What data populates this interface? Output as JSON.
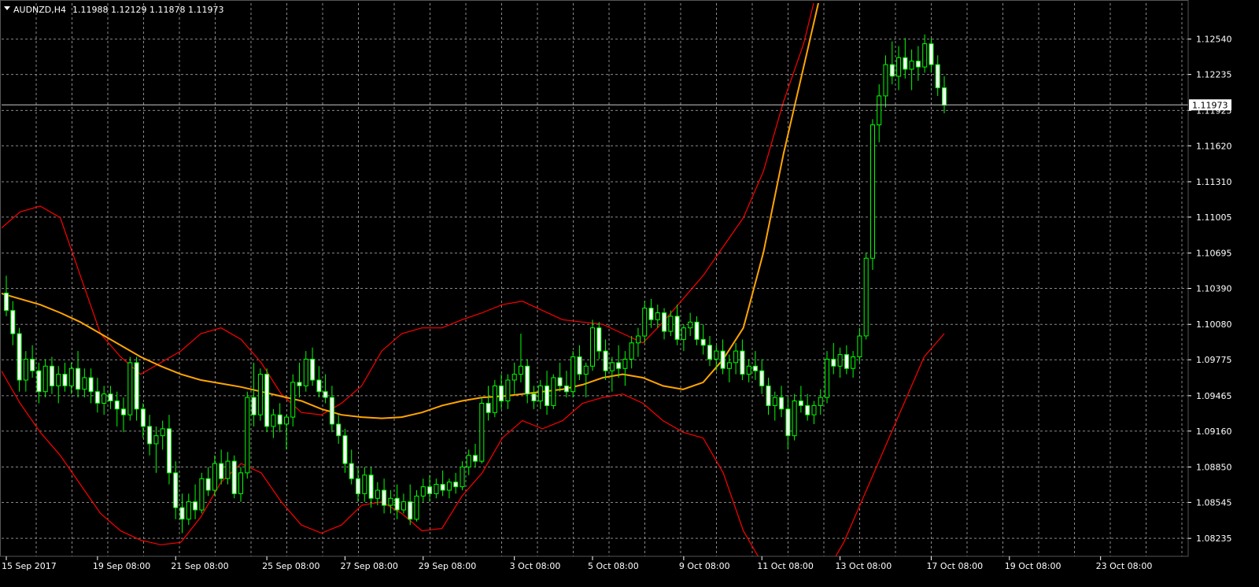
{
  "header": {
    "symbol": "AUDNZD,H4",
    "ohlc": "1.11988 1.12129 1.11878 1.11973"
  },
  "colors": {
    "background": "#000000",
    "grid": "#8a8a8a",
    "axis": "#ffffff",
    "bull_candle": "#00ff00",
    "bull_body": "#000000",
    "bear_candle": "#00ff00",
    "bear_body": "#ffffff",
    "bollinger": "#ff0000",
    "moving_average": "#ffa500",
    "price_line": "#c8c8c8"
  },
  "chart_data": {
    "type": "candlestick",
    "symbol": "AUDNZD",
    "timeframe": "H4",
    "current_price": "1.11973",
    "ylim": [
      1.0808,
      1.1285
    ],
    "y_ticks": [
      "1.12540",
      "1.12235",
      "1.11925",
      "1.11620",
      "1.11310",
      "1.11005",
      "1.10695",
      "1.10390",
      "1.10080",
      "1.09775",
      "1.09465",
      "1.09160",
      "1.08850",
      "1.08545",
      "1.08235"
    ],
    "x_ticks": [
      {
        "label": "15 Sep 2017",
        "bar": 0
      },
      {
        "label": "19 Sep 08:00",
        "bar": 14
      },
      {
        "label": "21 Sep 08:00",
        "bar": 26
      },
      {
        "label": "25 Sep 08:00",
        "bar": 40
      },
      {
        "label": "27 Sep 08:00",
        "bar": 52
      },
      {
        "label": "29 Sep 08:00",
        "bar": 64
      },
      {
        "label": "3 Oct 08:00",
        "bar": 78
      },
      {
        "label": "5 Oct 08:00",
        "bar": 90
      },
      {
        "label": "9 Oct 08:00",
        "bar": 104
      },
      {
        "label": "11 Oct 08:00",
        "bar": 116
      },
      {
        "label": "13 Oct 08:00",
        "bar": 128
      },
      {
        "label": "17 Oct 08:00",
        "bar": 142
      },
      {
        "label": "19 Oct 08:00",
        "bar": 154
      },
      {
        "label": "23 Oct 08:00",
        "bar": 168
      }
    ],
    "candles": [
      [
        1.1035,
        1.105,
        1.1015,
        1.102
      ],
      [
        1.102,
        1.1028,
        1.099,
        1.1
      ],
      [
        1.1,
        1.1005,
        1.095,
        1.096
      ],
      [
        1.096,
        1.0985,
        1.095,
        1.0978
      ],
      [
        1.0978,
        1.099,
        1.0962,
        1.0968
      ],
      [
        1.0968,
        1.0975,
        1.094,
        1.095
      ],
      [
        1.095,
        1.0978,
        1.0945,
        1.0972
      ],
      [
        1.0972,
        1.098,
        1.0948,
        1.0955
      ],
      [
        1.0955,
        1.0972,
        1.094,
        1.0965
      ],
      [
        1.0965,
        1.0975,
        1.095,
        1.0955
      ],
      [
        1.0955,
        1.0975,
        1.0948,
        1.097
      ],
      [
        1.097,
        1.0985,
        1.0945,
        1.0952
      ],
      [
        1.0952,
        1.097,
        1.0945,
        1.0962
      ],
      [
        1.0962,
        1.097,
        1.094,
        1.095
      ],
      [
        1.095,
        1.0962,
        1.0932,
        1.094
      ],
      [
        1.094,
        1.0955,
        1.093,
        1.0948
      ],
      [
        1.0948,
        1.0955,
        1.0935,
        1.0942
      ],
      [
        1.0942,
        1.095,
        1.092,
        1.0935
      ],
      [
        1.0935,
        1.0945,
        1.0915,
        1.093
      ],
      [
        1.093,
        1.098,
        1.0925,
        1.0975
      ],
      [
        1.0975,
        1.098,
        1.0925,
        1.0935
      ],
      [
        1.0935,
        1.094,
        1.091,
        1.092
      ],
      [
        1.092,
        1.093,
        1.0895,
        1.0905
      ],
      [
        1.0905,
        1.092,
        1.088,
        1.0912
      ],
      [
        1.0912,
        1.0925,
        1.09,
        1.0918
      ],
      [
        1.0918,
        1.093,
        1.087,
        1.088
      ],
      [
        1.088,
        1.089,
        1.084,
        1.085
      ],
      [
        1.085,
        1.0862,
        1.0828,
        1.084
      ],
      [
        1.084,
        1.0862,
        1.0835,
        1.0855
      ],
      [
        1.0855,
        1.087,
        1.084,
        1.0848
      ],
      [
        1.0848,
        1.088,
        1.0845,
        1.0875
      ],
      [
        1.0875,
        1.0885,
        1.086,
        1.0865
      ],
      [
        1.0865,
        1.0895,
        1.086,
        1.0888
      ],
      [
        1.0888,
        1.09,
        1.087,
        1.0875
      ],
      [
        1.0875,
        1.0898,
        1.087,
        1.089
      ],
      [
        1.089,
        1.0895,
        1.0858,
        1.0862
      ],
      [
        1.0862,
        1.0885,
        1.0855,
        1.088
      ],
      [
        1.088,
        1.095,
        1.0875,
        1.0945
      ],
      [
        1.0945,
        1.0975,
        1.092,
        1.093
      ],
      [
        1.093,
        1.097,
        1.0925,
        1.0965
      ],
      [
        1.0965,
        1.097,
        1.0915,
        1.092
      ],
      [
        1.092,
        1.0935,
        1.091,
        1.093
      ],
      [
        1.093,
        1.094,
        1.0915,
        1.0922
      ],
      [
        1.0922,
        1.093,
        1.09,
        1.0928
      ],
      [
        1.0928,
        1.0965,
        1.092,
        1.0958
      ],
      [
        1.0958,
        1.0975,
        1.0945,
        1.0955
      ],
      [
        1.0955,
        1.0985,
        1.095,
        1.0978
      ],
      [
        1.0978,
        1.0988,
        1.0955,
        1.096
      ],
      [
        1.096,
        1.0972,
        1.0945,
        1.095
      ],
      [
        1.095,
        1.0965,
        1.094,
        1.0945
      ],
      [
        1.0945,
        1.0955,
        1.0915,
        1.0922
      ],
      [
        1.0922,
        1.093,
        1.0905,
        1.0912
      ],
      [
        1.0912,
        1.0918,
        1.088,
        1.0888
      ],
      [
        1.0888,
        1.09,
        1.087,
        1.0875
      ],
      [
        1.0875,
        1.0885,
        1.0855,
        1.0862
      ],
      [
        1.0862,
        1.0885,
        1.0855,
        1.0878
      ],
      [
        1.0878,
        1.0885,
        1.085,
        1.0858
      ],
      [
        1.0858,
        1.0872,
        1.0852,
        1.0865
      ],
      [
        1.0865,
        1.0875,
        1.0845,
        1.0852
      ],
      [
        1.0852,
        1.0865,
        1.0845,
        1.0858
      ],
      [
        1.0858,
        1.087,
        1.084,
        1.0848
      ],
      [
        1.0848,
        1.0862,
        1.0845,
        1.0855
      ],
      [
        1.0855,
        1.087,
        1.0835,
        1.084
      ],
      [
        1.084,
        1.0865,
        1.0838,
        1.086
      ],
      [
        1.086,
        1.0875,
        1.0855,
        1.0868
      ],
      [
        1.0868,
        1.0878,
        1.0855,
        1.0862
      ],
      [
        1.0862,
        1.0875,
        1.0858,
        1.087
      ],
      [
        1.087,
        1.0882,
        1.086,
        1.0865
      ],
      [
        1.0865,
        1.0875,
        1.0858,
        1.0872
      ],
      [
        1.0872,
        1.088,
        1.0862,
        1.0868
      ],
      [
        1.0868,
        1.089,
        1.0865,
        1.0885
      ],
      [
        1.0885,
        1.09,
        1.0878,
        1.0895
      ],
      [
        1.0895,
        1.0905,
        1.0885,
        1.089
      ],
      [
        1.089,
        1.0945,
        1.0888,
        1.094
      ],
      [
        1.094,
        1.0955,
        1.0925,
        1.0932
      ],
      [
        1.0932,
        1.096,
        1.0928,
        1.0955
      ],
      [
        1.0955,
        1.0965,
        1.0935,
        1.0942
      ],
      [
        1.0942,
        1.0965,
        1.0935,
        1.096
      ],
      [
        1.096,
        1.0975,
        1.0948,
        1.0965
      ],
      [
        1.0965,
        1.1,
        1.0958,
        1.0972
      ],
      [
        1.0972,
        1.0978,
        1.094,
        1.0948
      ],
      [
        1.0948,
        1.0955,
        1.0935,
        1.0942
      ],
      [
        1.0942,
        1.096,
        1.0935,
        1.0955
      ],
      [
        1.0955,
        1.0968,
        1.093,
        1.0938
      ],
      [
        1.0938,
        1.0965,
        1.0935,
        1.0962
      ],
      [
        1.0962,
        1.0975,
        1.095,
        1.0955
      ],
      [
        1.0955,
        1.0968,
        1.0945,
        1.095
      ],
      [
        1.095,
        1.0985,
        1.0945,
        1.098
      ],
      [
        1.098,
        1.099,
        1.096,
        1.0965
      ],
      [
        1.0965,
        1.0975,
        1.0945,
        1.0972
      ],
      [
        1.0972,
        1.1012,
        1.0968,
        1.1005
      ],
      [
        1.1005,
        1.101,
        1.0978,
        1.0985
      ],
      [
        1.0985,
        1.0995,
        1.096,
        1.0968
      ],
      [
        1.0968,
        1.098,
        1.095,
        1.0975
      ],
      [
        1.0975,
        1.099,
        1.0962,
        1.097
      ],
      [
        1.097,
        1.0985,
        1.0955,
        1.0978
      ],
      [
        1.0978,
        1.0998,
        1.097,
        1.0992
      ],
      [
        1.0992,
        1.1005,
        1.098,
        1.0998
      ],
      [
        1.0998,
        1.1028,
        1.0992,
        1.1022
      ],
      [
        1.1022,
        1.103,
        1.1005,
        1.1012
      ],
      [
        1.1012,
        1.1025,
        1.1005,
        1.1018
      ],
      [
        1.1018,
        1.1022,
        1.0995,
        1.1002
      ],
      [
        1.1002,
        1.102,
        1.0998,
        1.1015
      ],
      [
        1.1015,
        1.1025,
        1.099,
        1.0995
      ],
      [
        1.0995,
        1.1008,
        1.0985,
        1.1005
      ],
      [
        1.1005,
        1.1018,
        1.0998,
        1.101
      ],
      [
        1.101,
        1.1015,
        1.099,
        1.0995
      ],
      [
        1.0995,
        1.1008,
        1.0982,
        1.099
      ],
      [
        1.099,
        1.0998,
        1.0972,
        1.0978
      ],
      [
        1.0978,
        1.099,
        1.0968,
        1.0985
      ],
      [
        1.0985,
        1.0995,
        1.0965,
        1.097
      ],
      [
        1.097,
        1.0982,
        1.0958,
        1.0975
      ],
      [
        1.0975,
        1.0992,
        1.0965,
        1.0985
      ],
      [
        1.0985,
        1.0995,
        1.096,
        1.0965
      ],
      [
        1.0965,
        1.0978,
        1.0958,
        1.0972
      ],
      [
        1.0972,
        1.0985,
        1.096,
        1.0968
      ],
      [
        1.0968,
        1.0978,
        1.0948,
        1.0955
      ],
      [
        1.0955,
        1.0962,
        1.093,
        1.0938
      ],
      [
        1.0938,
        1.095,
        1.0925,
        1.0945
      ],
      [
        1.0945,
        1.0955,
        1.0928,
        1.0935
      ],
      [
        1.0935,
        1.0945,
        1.09,
        1.0912
      ],
      [
        1.0912,
        1.0948,
        1.0908,
        1.0942
      ],
      [
        1.0942,
        1.0955,
        1.0932,
        1.0938
      ],
      [
        1.0938,
        1.0948,
        1.0925,
        1.093
      ],
      [
        1.093,
        1.0942,
        1.0922,
        1.0938
      ],
      [
        1.0938,
        1.0952,
        1.093,
        1.0945
      ],
      [
        1.0945,
        1.0985,
        1.094,
        1.0978
      ],
      [
        1.0978,
        1.0992,
        1.0965,
        1.0972
      ],
      [
        1.0972,
        1.0988,
        1.0962,
        1.0982
      ],
      [
        1.0982,
        1.099,
        1.0965,
        1.097
      ],
      [
        1.097,
        1.0985,
        1.0962,
        1.098
      ],
      [
        1.098,
        1.1005,
        1.0975,
        1.0998
      ],
      [
        1.0998,
        1.107,
        1.0995,
        1.1065
      ],
      [
        1.1065,
        1.1185,
        1.1055,
        1.118
      ],
      [
        1.118,
        1.1215,
        1.1165,
        1.1205
      ],
      [
        1.1205,
        1.124,
        1.1195,
        1.1232
      ],
      [
        1.1232,
        1.1252,
        1.1215,
        1.1222
      ],
      [
        1.1222,
        1.1248,
        1.121,
        1.1238
      ],
      [
        1.1238,
        1.1255,
        1.122,
        1.1228
      ],
      [
        1.1228,
        1.1245,
        1.121,
        1.1235
      ],
      [
        1.1235,
        1.1248,
        1.1218,
        1.123
      ],
      [
        1.123,
        1.1258,
        1.1225,
        1.125
      ],
      [
        1.125,
        1.1255,
        1.1225,
        1.1232
      ],
      [
        1.1232,
        1.124,
        1.1205,
        1.1212
      ],
      [
        1.1212,
        1.1222,
        1.119,
        1.1197
      ]
    ],
    "bands": {
      "ma": [
        1.1035,
        1.103,
        1.1025,
        1.1018,
        1.101,
        1.1,
        1.099,
        1.098,
        1.0972,
        1.0965,
        1.096,
        1.0957,
        1.0954,
        1.095,
        1.0946,
        1.0942,
        1.0935,
        1.093,
        1.0928,
        1.0927,
        1.0928,
        1.0932,
        1.0938,
        1.0942,
        1.0945,
        1.0946,
        1.0948,
        1.095,
        1.0952,
        1.0956,
        1.0962,
        1.0965,
        1.0962,
        1.0955,
        1.0952,
        1.0958,
        1.0978,
        1.1005,
        1.107,
        1.1155,
        1.123,
        1.1305,
        1.137,
        1.143,
        1.148,
        1.153,
        1.156,
        1.1595
      ],
      "upper": [
        1.109,
        1.1105,
        1.111,
        1.11,
        1.105,
        1.1,
        1.098,
        1.0965,
        1.0975,
        1.0985,
        1.1,
        1.1005,
        1.0995,
        1.0975,
        1.0948,
        1.0932,
        1.093,
        1.094,
        1.0955,
        1.0985,
        1.1,
        1.1005,
        1.1005,
        1.1012,
        1.1018,
        1.1025,
        1.1028,
        1.102,
        1.1012,
        1.101,
        1.1008,
        1.1,
        1.0992,
        1.101,
        1.103,
        1.105,
        1.1075,
        1.11,
        1.114,
        1.12,
        1.125,
        1.132,
        1.14,
        1.148,
        1.155,
        1.162,
        1.17,
        1.18
      ],
      "lower": [
        1.097,
        1.094,
        1.0915,
        1.0895,
        1.087,
        1.0845,
        1.083,
        1.0822,
        1.0818,
        1.082,
        1.0842,
        1.0872,
        1.0888,
        1.088,
        1.0855,
        1.0835,
        1.0828,
        1.0835,
        1.0852,
        1.0855,
        1.0845,
        1.083,
        1.0832,
        1.086,
        1.088,
        1.091,
        1.0925,
        1.0918,
        1.0925,
        1.094,
        1.0945,
        1.0948,
        1.094,
        1.0925,
        1.0915,
        1.091,
        1.088,
        1.083,
        1.08,
        1.078,
        1.077,
        1.079,
        1.082,
        1.086,
        1.09,
        1.094,
        1.098,
        1.1
      ]
    }
  }
}
